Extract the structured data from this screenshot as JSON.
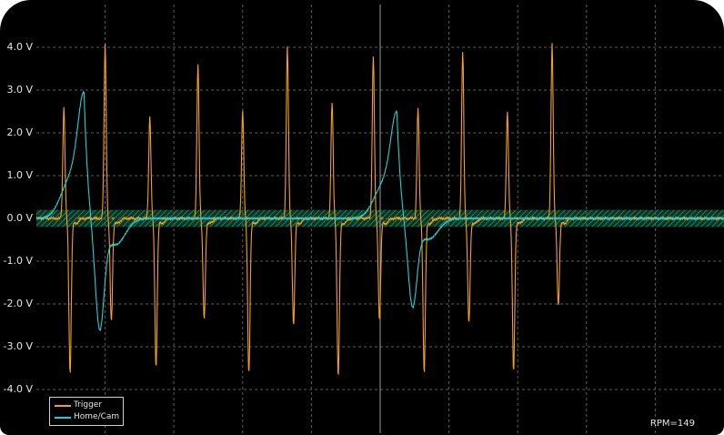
{
  "chart_data": {
    "type": "line",
    "title": "",
    "xlabel": "",
    "ylabel": "",
    "ylim": [
      -4.5,
      4.5
    ],
    "y_ticks": [
      "4.0 V",
      "3.0 V",
      "2.0 V",
      "1.0 V",
      "0.0 V",
      "-1.0 V",
      "-2.0 V",
      "-3.0 V",
      "-4.0 V"
    ],
    "y_tick_values": [
      4,
      3,
      2,
      1,
      0,
      -1,
      -2,
      -3,
      -4
    ],
    "grid": true,
    "legend_position": "bottom-left",
    "x_divisions": 10,
    "trigger_band": [
      -0.2,
      0.2
    ],
    "series": [
      {
        "name": "Trigger",
        "color": "#f5a020",
        "pulses": [
          {
            "t": 0.04,
            "pos": 2.6,
            "neg": -3.6
          },
          {
            "t": 0.1,
            "pos": 4.1,
            "neg": -2.4
          },
          {
            "t": 0.165,
            "pos": 2.4,
            "neg": -3.45
          },
          {
            "t": 0.235,
            "pos": 3.6,
            "neg": -2.35
          },
          {
            "t": 0.3,
            "pos": 2.55,
            "neg": -3.6
          },
          {
            "t": 0.365,
            "pos": 4.0,
            "neg": -2.45
          },
          {
            "t": 0.43,
            "pos": 2.7,
            "neg": -3.7
          },
          {
            "t": 0.49,
            "pos": 3.8,
            "neg": -2.35
          },
          {
            "t": 0.555,
            "pos": 2.55,
            "neg": -3.6
          },
          {
            "t": 0.62,
            "pos": 3.9,
            "neg": -2.45
          },
          {
            "t": 0.685,
            "pos": 2.5,
            "neg": -3.55
          },
          {
            "t": 0.75,
            "pos": 4.1,
            "neg": -2.0
          }
        ]
      },
      {
        "name": "Home/Cam",
        "color": "#22d0d4",
        "events": [
          {
            "t": 0.07,
            "peak": 2.6,
            "trough": -2.45
          },
          {
            "t": 0.525,
            "peak": 2.2,
            "trough": -1.95
          }
        ]
      }
    ]
  },
  "legend": {
    "items": [
      {
        "label": "Trigger",
        "color": "#f5a020"
      },
      {
        "label": "Home/Cam",
        "color": "#22d0d4"
      }
    ]
  },
  "readout": {
    "rpm": "RPM=149"
  }
}
